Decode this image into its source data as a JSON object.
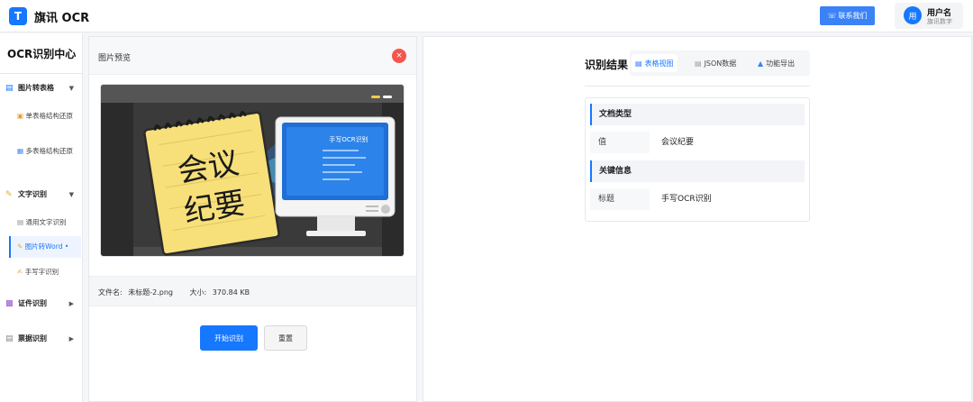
{
  "header": {
    "logo_letter": "T",
    "app_title": "旗讯 OCR",
    "contact_label": "联系我们",
    "user": {
      "avatar_text": "用",
      "name": "用户名",
      "org": "旗讯数字"
    }
  },
  "sidebar": {
    "title": "OCR识别中心",
    "groups": [
      {
        "label": "图片转表格",
        "expanded": true,
        "items": [
          "单表格结构还原",
          "多表格结构还原"
        ]
      },
      {
        "label": "文字识别",
        "expanded": true,
        "items": [
          "通用文字识别",
          "图片转Word •",
          "手写字识别"
        ]
      },
      {
        "label": "证件识别",
        "expanded": false,
        "items": []
      },
      {
        "label": "票据识别",
        "expanded": false,
        "items": []
      }
    ],
    "active_item": "图片转Word •"
  },
  "preview": {
    "title": "图片预览",
    "close_label": "×",
    "image_caption": {
      "notebook_line1": "会议",
      "notebook_line2": "纪要",
      "monitor_label": "手写OCR识别"
    },
    "file_name_label": "文件名:",
    "file_name": "未标题-2.png",
    "size_label": "大小:",
    "size": "370.84 KB",
    "start_button": "开始识别",
    "reset_button": "重置"
  },
  "result": {
    "title": "识别结果",
    "tabs": [
      {
        "label": "表格视图",
        "icon": "bar-chart-icon",
        "active": true
      },
      {
        "label": "JSON数据",
        "icon": "document-icon",
        "active": false
      },
      {
        "label": "功能导出",
        "icon": "export-icon",
        "active": false
      }
    ],
    "sections": [
      {
        "heading": "文档类型",
        "key": "值",
        "value": "会议纪要"
      },
      {
        "heading": "关键信息",
        "key": "标题",
        "value": "手写OCR识别"
      }
    ]
  },
  "colors": {
    "accent": "#1677ff",
    "danger": "#f5554a",
    "notebook": "#f7e07a",
    "monitor_screen": "#1f6fd6"
  }
}
